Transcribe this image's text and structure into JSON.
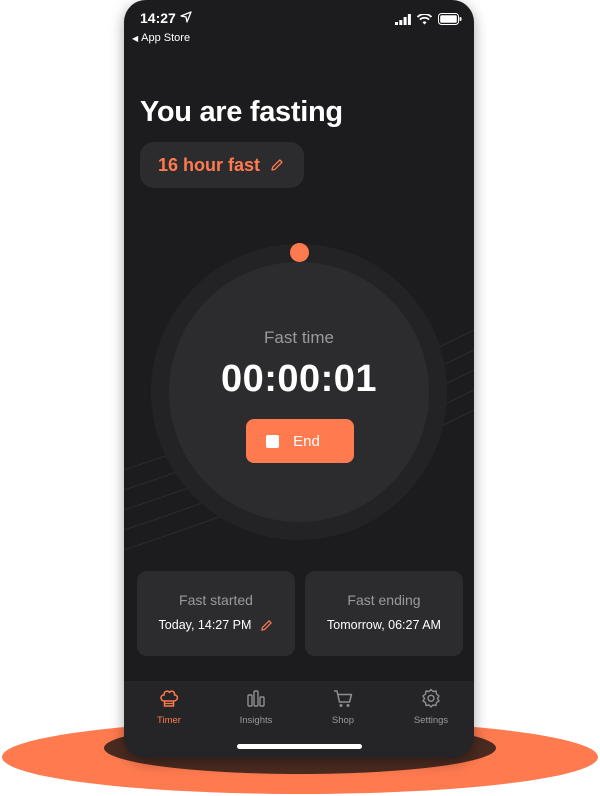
{
  "status_bar": {
    "time": "14:27",
    "back_label": "App Store"
  },
  "main": {
    "heading": "You are fasting",
    "fast_plan": "16 hour fast",
    "timer_label": "Fast time",
    "timer_value": "00:00:01",
    "end_label": "End",
    "progress_fraction": 0
  },
  "cards": {
    "started_title": "Fast started",
    "started_value": "Today, 14:27 PM",
    "ending_title": "Fast ending",
    "ending_value": "Tomorrow, 06:27 AM"
  },
  "tabs": [
    {
      "label": "Timer",
      "icon": "chef-hat-icon",
      "active": true
    },
    {
      "label": "Insights",
      "icon": "bar-chart-icon",
      "active": false
    },
    {
      "label": "Shop",
      "icon": "cart-icon",
      "active": false
    },
    {
      "label": "Settings",
      "icon": "gear-icon",
      "active": false
    }
  ],
  "colors": {
    "accent": "#ff7a4f",
    "background": "#1c1c1e",
    "surface": "#2c2c2e"
  }
}
